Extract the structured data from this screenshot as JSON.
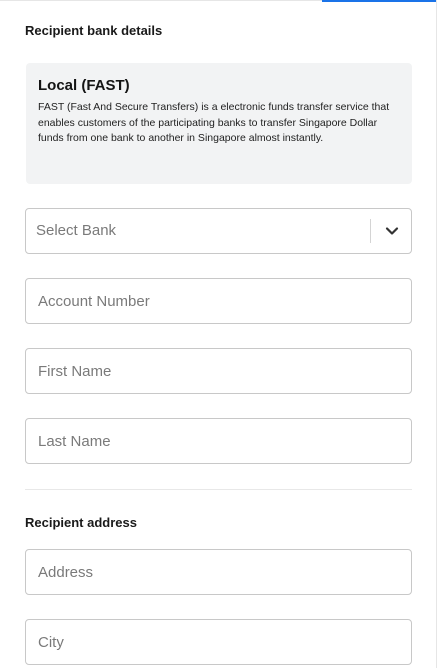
{
  "bank_section": {
    "heading": "Recipient bank details",
    "transfer_type": {
      "title": "Local (FAST)",
      "description": "FAST (Fast And Secure Transfers) is a electronic funds transfer service that enables customers of the participating banks to transfer Singapore Dollar funds from one bank to another in Singapore almost instantly."
    },
    "bank_select": {
      "value": "Select Bank",
      "icon": "chevron-down-icon"
    },
    "account_number": {
      "placeholder": "Account Number",
      "value": ""
    },
    "first_name": {
      "placeholder": "First Name",
      "value": ""
    },
    "last_name": {
      "placeholder": "Last Name",
      "value": ""
    }
  },
  "address_section": {
    "heading": "Recipient address",
    "address": {
      "placeholder": "Address",
      "value": ""
    },
    "city": {
      "placeholder": "City",
      "value": ""
    }
  },
  "colors": {
    "accent": "#1a73e8",
    "card_background": "#f2f3f4",
    "field_border": "#c8c8c8",
    "placeholder_text": "#7a7a7a"
  }
}
